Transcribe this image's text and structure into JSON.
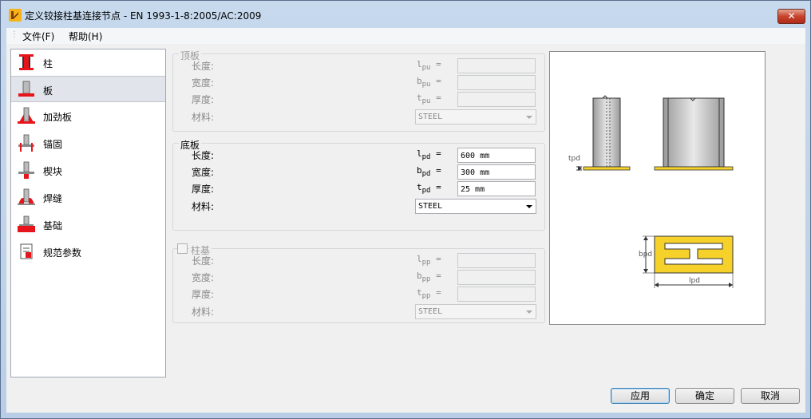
{
  "window": {
    "title": "定义铰接柱基连接节点 - EN 1993-1-8:2005/AC:2009",
    "close_glyph": "✕"
  },
  "menu": {
    "items": [
      "文件(F)",
      "帮助(H)"
    ]
  },
  "sidebar": {
    "selected_index": 1,
    "items": [
      {
        "label": "柱",
        "icon": "column-icon"
      },
      {
        "label": "板",
        "icon": "plate-icon"
      },
      {
        "label": "加劲板",
        "icon": "stiffener-icon"
      },
      {
        "label": "锚固",
        "icon": "anchor-icon"
      },
      {
        "label": "楔块",
        "icon": "shear-key-icon"
      },
      {
        "label": "焊缝",
        "icon": "weld-icon"
      },
      {
        "label": "基础",
        "icon": "foundation-icon"
      },
      {
        "label": "规范参数",
        "icon": "code-params-icon"
      }
    ]
  },
  "top_plate": {
    "title": "顶板",
    "enabled": false,
    "length_label": "长度:",
    "width_label": "宽度:",
    "thickness_label": "厚度:",
    "material_label": "材料:",
    "length_sym": "l",
    "width_sym": "b",
    "thickness_sym": "t",
    "sub": "pu",
    "length_value": "",
    "width_value": "",
    "thickness_value": "",
    "material": "STEEL"
  },
  "base_plate": {
    "title": "底板",
    "enabled": true,
    "length_label": "长度:",
    "width_label": "宽度:",
    "thickness_label": "厚度:",
    "material_label": "材料:",
    "length_sym": "l",
    "width_sym": "b",
    "thickness_sym": "t",
    "sub": "pd",
    "length_value": "600 mm",
    "width_value": "300 mm",
    "thickness_value": "25 mm",
    "material": "STEEL"
  },
  "column_base": {
    "title": "柱基",
    "enabled": false,
    "checked": false,
    "length_label": "长度:",
    "width_label": "宽度:",
    "thickness_label": "厚度:",
    "material_label": "材料:",
    "length_sym": "l",
    "width_sym": "b",
    "thickness_sym": "t",
    "sub": "pp",
    "length_value": "",
    "width_value": "",
    "thickness_value": "",
    "material": "STEEL"
  },
  "preview": {
    "tpd_label": "tpd",
    "bpd_label": "bpd",
    "lpd_label": "lpd"
  },
  "buttons": {
    "apply": "应用",
    "ok": "确定",
    "cancel": "取消"
  },
  "colors": {
    "accent_red": "#e8141c",
    "plate_yellow": "#f5d12a",
    "titlebar": "#c2d6ec"
  }
}
